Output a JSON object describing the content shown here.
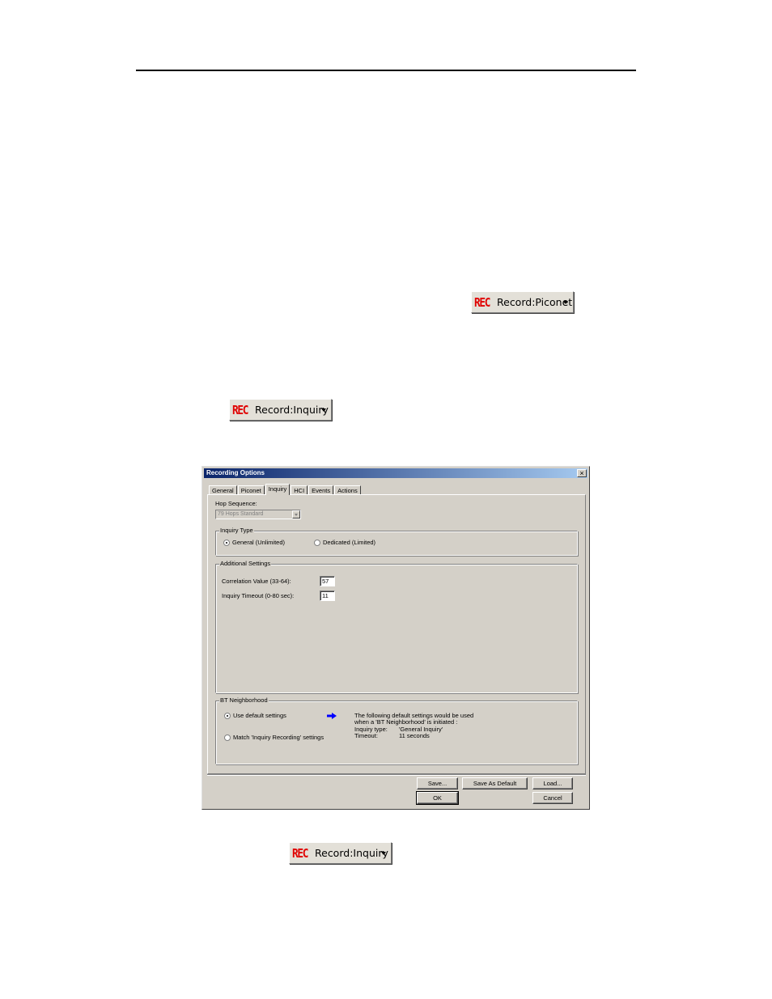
{
  "toolbar_buttons": {
    "rec_glyph": "REC",
    "record_piconet": "Record:Piconet",
    "record_inquiry_1": "Record:Inquiry",
    "record_inquiry_2": "Record:Inquiry"
  },
  "dialog": {
    "title": "Recording Options",
    "close_label": "×",
    "tabs": [
      "General",
      "Piconet",
      "Inquiry",
      "HCI",
      "Events",
      "Actions"
    ],
    "active_tab": "Inquiry",
    "hop_sequence": {
      "label": "Hop Sequence:",
      "value": "79 Hops Standard"
    },
    "inquiry_type": {
      "legend": "Inquiry Type",
      "options": [
        "General (Unlimited)",
        "Dedicated (Limited)"
      ],
      "selected": "General (Unlimited)"
    },
    "additional_settings": {
      "legend": "Additional Settings",
      "correlation_label": "Correlation Value (33-64):",
      "correlation_value": "57",
      "timeout_label": "Inquiry Timeout (0-80 sec):",
      "timeout_value": "11"
    },
    "bt_neighborhood": {
      "legend": "BT Neighborhood",
      "option_default": "Use default settings",
      "option_match": "Match 'Inquiry Recording' settings",
      "selected": "Use default settings",
      "info_line1": "The following default settings would be used",
      "info_line2": "when a 'BT Neighborhood' is initiated :",
      "inquiry_type_label": "Inquiry type:",
      "inquiry_type_value": "'General Inquiry'",
      "timeout_label": "Timeout:",
      "timeout_value": "11 seconds"
    },
    "buttons": {
      "save": "Save...",
      "save_default": "Save As Default",
      "load": "Load...",
      "ok": "OK",
      "cancel": "Cancel"
    }
  },
  "colors": {
    "rec_red": "#e00000",
    "dialog_face": "#d4d0c8",
    "titlebar_start": "#0a246a",
    "titlebar_end": "#a6caf0",
    "arrow_blue": "#0000ff"
  }
}
